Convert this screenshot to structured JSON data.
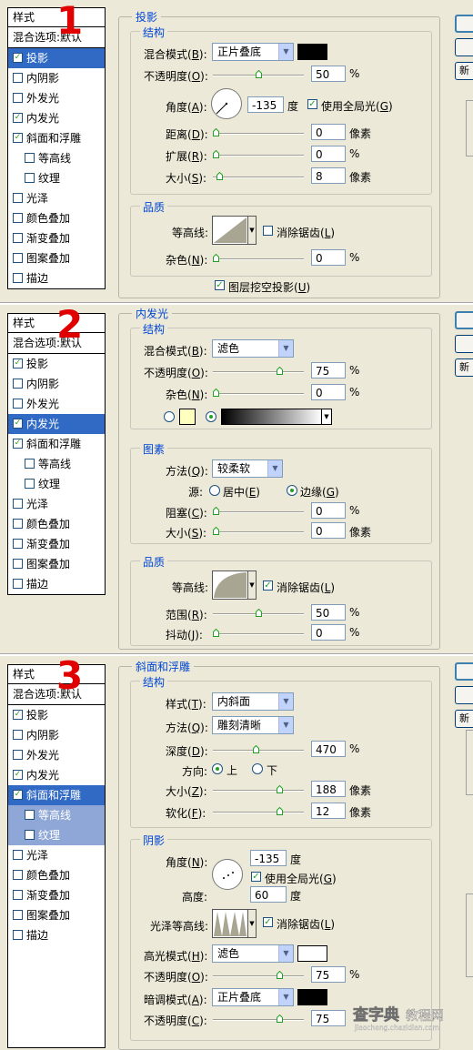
{
  "labels": {
    "n1": "1",
    "n2": "2",
    "n3": "3"
  },
  "styles": {
    "header": "样式",
    "blend": "混合选项:默认",
    "drop_shadow": "投影",
    "inner_shadow": "内阴影",
    "outer_glow": "外发光",
    "inner_glow": "内发光",
    "bevel": "斜面和浮雕",
    "contour": "等高线",
    "texture": "纹理",
    "satin": "光泽",
    "color_overlay": "颜色叠加",
    "gradient_overlay": "渐变叠加",
    "pattern_overlay": "图案叠加",
    "stroke": "描边"
  },
  "buttons": {
    "new_label": "新"
  },
  "units": {
    "percent": "%",
    "pixels": "像素",
    "degree": "度"
  },
  "p1": {
    "title": "投影",
    "structure": "结构",
    "blend_mode_label": "混合模式(",
    "blend_mode_key": "B",
    "blend_mode_value": "正片叠底",
    "opacity_label": "不透明度(",
    "opacity_key": "O",
    "opacity_value": "50",
    "angle_label": "角度(",
    "angle_key": "A",
    "angle_value": "-135",
    "global_light_label": "使用全局光(",
    "global_light_key": "G",
    "distance_label": "距离(",
    "distance_key": "D",
    "distance_value": "0",
    "spread_label": "扩展(",
    "spread_key": "R",
    "spread_value": "0",
    "size_label": "大小(",
    "size_key": "S",
    "size_value": "8",
    "quality": "品质",
    "contour_label": "等高线:",
    "antialias_label": "消除锯齿(",
    "antialias_key": "L",
    "noise_label": "杂色(",
    "noise_key": "N",
    "noise_value": "0",
    "knockout_label": "图层挖空投影(",
    "knockout_key": "U",
    "shadow_color": "#000000"
  },
  "p2": {
    "title": "内发光",
    "structure": "结构",
    "blend_mode_label": "混合模式(",
    "blend_mode_key": "B",
    "blend_mode_value": "滤色",
    "opacity_label": "不透明度(",
    "opacity_key": "O",
    "opacity_value": "75",
    "noise_label": "杂色(",
    "noise_key": "N",
    "noise_value": "0",
    "glow_color": "#ffffc0",
    "elements": "图素",
    "technique_label": "方法(",
    "technique_key": "Q",
    "technique_value": "较柔软",
    "source_label": "源:",
    "center_label": "居中(",
    "center_key": "E",
    "edge_label": "边缘(",
    "edge_key": "G",
    "choke_label": "阻塞(",
    "choke_key": "C",
    "choke_value": "0",
    "size_label": "大小(",
    "size_key": "S",
    "size_value": "0",
    "quality": "品质",
    "contour_label": "等高线:",
    "antialias_label": "消除锯齿(",
    "antialias_key": "L",
    "range_label": "范围(",
    "range_key": "R",
    "range_value": "50",
    "jitter_label": "抖动(",
    "jitter_key": "J",
    "jitter_value": "0"
  },
  "p3": {
    "title": "斜面和浮雕",
    "structure": "结构",
    "style_label": "样式(",
    "style_key": "T",
    "style_value": "内斜面",
    "technique_label": "方法(",
    "technique_key": "Q",
    "technique_value": "雕刻清晰",
    "depth_label": "深度(",
    "depth_key": "D",
    "depth_value": "470",
    "direction_label": "方向:",
    "up_label": "上",
    "down_label": "下",
    "size_label": "大小(",
    "size_key": "Z",
    "size_value": "188",
    "soften_label": "软化(",
    "soften_key": "F",
    "soften_value": "12",
    "shading": "阴影",
    "angle_label": "角度(",
    "angle_key": "N",
    "angle_value": "-135",
    "global_light_label": "使用全局光(",
    "global_light_key": "G",
    "altitude_label": "高度:",
    "altitude_value": "60",
    "gloss_label": "光泽等高线:",
    "antialias_label": "消除锯齿(",
    "antialias_key": "L",
    "highlight_label": "高光模式(",
    "highlight_key": "H",
    "highlight_value": "滤色",
    "highlight_color": "#ffffff",
    "hl_opacity_label": "不透明度(",
    "hl_opacity_key": "O",
    "hl_opacity_value": "75",
    "shadow_mode_label": "暗调模式(",
    "shadow_mode_key": "A",
    "shadow_mode_value": "正片叠底",
    "shadow_color": "#000000",
    "sh_opacity_label": "不透明度(",
    "sh_opacity_key": "C",
    "sh_opacity_value": "75"
  },
  "watermark": {
    "brand": "查字典",
    "site": "教程网",
    "url": "jiaocheng.chazidian.com"
  }
}
